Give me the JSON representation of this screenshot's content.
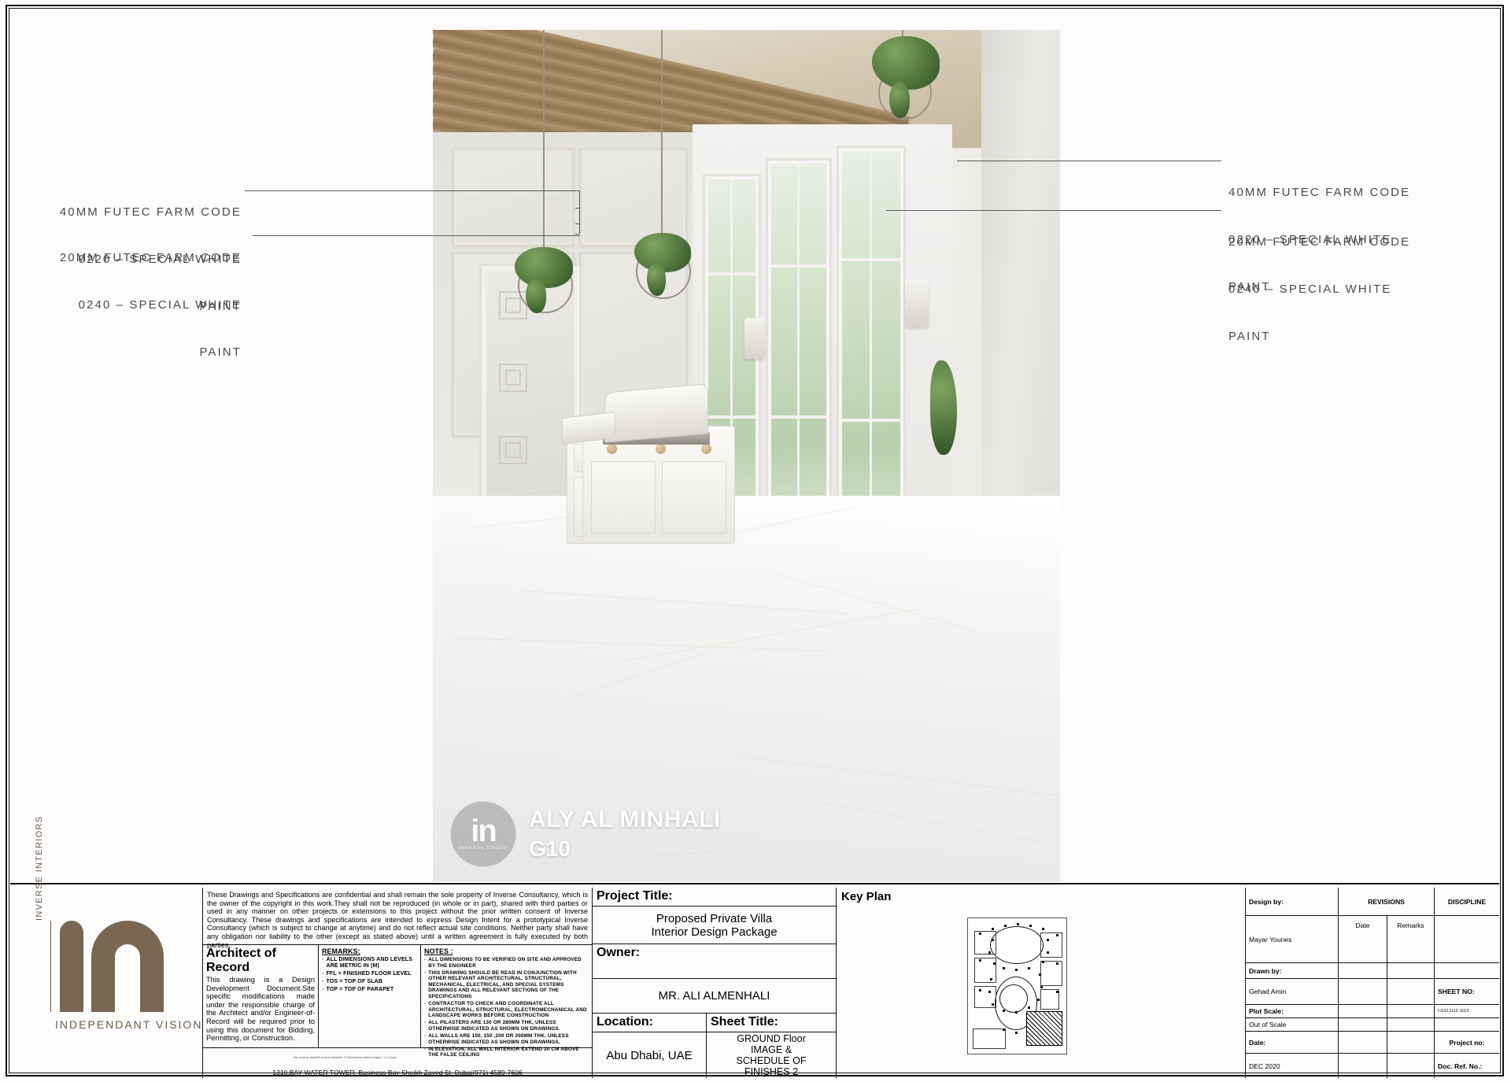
{
  "annotations": {
    "left": [
      {
        "line1": "40MM FUTEC FARM CODE",
        "line2": "0220 – SPECIAL WHITE",
        "line3": "PAINT"
      },
      {
        "line1": "20MM FUTEC FARM CODE",
        "line2": "0240 – SPECIAL WHITE",
        "line3": "PAINT"
      }
    ],
    "right": [
      {
        "line1": "40MM FUTEC FARM CODE",
        "line2": "0220 – SPECIAL WHITE",
        "line3": "PAINT"
      },
      {
        "line1": "20MM FUTEC FARM CODE",
        "line2": "0240 – SPECIAL WHITE",
        "line3": "PAINT"
      }
    ]
  },
  "watermark": {
    "logo_mark": "in",
    "logo_sub": "INVERSE GROUP",
    "project_name": "ALY AL MINHALI",
    "room_code": "G10"
  },
  "logo": {
    "vertical_text": "INVERSE INTERIORS",
    "tagline": "INDEPENDANT VISION",
    "color": "#7a6753"
  },
  "copyright": {
    "text": "These Drawings and Specifications are confidential and shall remain the sole property of Inverse Consultancy, which is the owner of the copyright in this work.They shall not be reproduced (in whole or in part), shared with third parties or used in any manner on other projects or extensions to this project without the prior written consent of Inverse Consultancy. These drawings and specifications are intended to express Design Intent for a prototypical Inverse Consultancy (which is subject to change at anytime) and do not reflect actual site conditions.  Neither party shall have any obligation nor liability to the other (except as stated above) until a written agreement is fully executed by both parties."
  },
  "architect_of_record": {
    "title": "Architect of Record",
    "body": "This drawing is a Design Development Document.Site specific modifications made under the responsible charge of the Architect and/or Engineer-of-Record will be required prior to using this document for Bidding, Permitting, or Construction."
  },
  "remarks": {
    "heading": "REMARKS;",
    "items": [
      "ALL DIMENSIONS AND LEVELS ARE METRIC IN (M)",
      "FFL = FINISHED FLOOR LEVEL",
      "TOS = TOP OF SLAB",
      "TOP = TOP OF PARAPET"
    ]
  },
  "notes": {
    "heading": "NOTES  :",
    "items": [
      "ALL DIMENSIONS TO BE VERIFIED ON SITE AND APPROVED BY THE ENGINEER",
      "THIS DRAWING SHOULD BE READ IN CONJUNCTION WITH OTHER RELEVANT ARCHITECTURAL, STRUCTURAL, MECHANICAL, ELECTRICAL, AND SPECIAL SYSTEMS DRAWINGS AND ALL RELEVANT SECTIONS OF THE SPECIFICATIONS",
      "CONTRACTOR TO CHECK AND COORDINATE ALL ARCHITECTURAL, STRUCTURAL, ELECTROMECHANICAL AND LANDSCAPE WORKS BEFORE CONSTRUCTION",
      "ALL PILASTERS ARE 130 OR 280MM THK, UNLESS OTHERWISE INDICATED AS SHOWN ON DRAWINGS.",
      "ALL WALLS ARE 100, 150 ,200 OR 300MM THK, UNLESS OTHERWISE INDICATED AS SHOWN ON DRAWINGS.",
      "IN ELEVATION, ALL WALL INTERIOR EXTEND 20 CM ABOVE THE FALSE CEILING"
    ]
  },
  "address": {
    "line": "1310,BAY WATER TOWER, Business Bay Sheikh Zayed St, Dubai(971) 4589-7606",
    "credit": "Mrs. Amal Al Jabari/Mr. Amal Al Jabari/Mr.  P.O.Box/Inverse Interior Design L.L.C.,Dubai"
  },
  "project": {
    "title_label": "Project Title:",
    "title_line1": "Proposed Private Villa",
    "title_line2": "Interior Design Package",
    "owner_label": "Owner:",
    "owner_value": "MR. ALI ALMENHALI",
    "location_label": "Location:",
    "location_value": "Abu Dhabi, UAE",
    "sheet_title_label": "Sheet Title:",
    "sheet_title_lines": [
      "GROUND Floor",
      "IMAGE &",
      "SCHEDULE OF",
      "FINISHES 2"
    ]
  },
  "key_plan": {
    "label": "Key Plan"
  },
  "revisions": {
    "design_by_label": "Design by:",
    "design_by_value": "Mayar Younes",
    "drawn_by_label": "Drawn by:",
    "drawn_by_value": "Gehad Amin",
    "plot_scale_label": "Plot Scale:",
    "plot_scale_value": "Out of Scale",
    "date_label": "Date:",
    "date_value": "DEC 2020",
    "revisions_header": "REVISIONS",
    "date_col": "Date",
    "remarks_col": "Remarks",
    "discipline_header": "DISCIPLINE",
    "sheet_no_label": "SHEET NO:",
    "sheet_no_value": "I-G11,G12-1113",
    "project_no_label": "Project no:",
    "doc_ref_label": "Doc. Ref. No.:"
  }
}
